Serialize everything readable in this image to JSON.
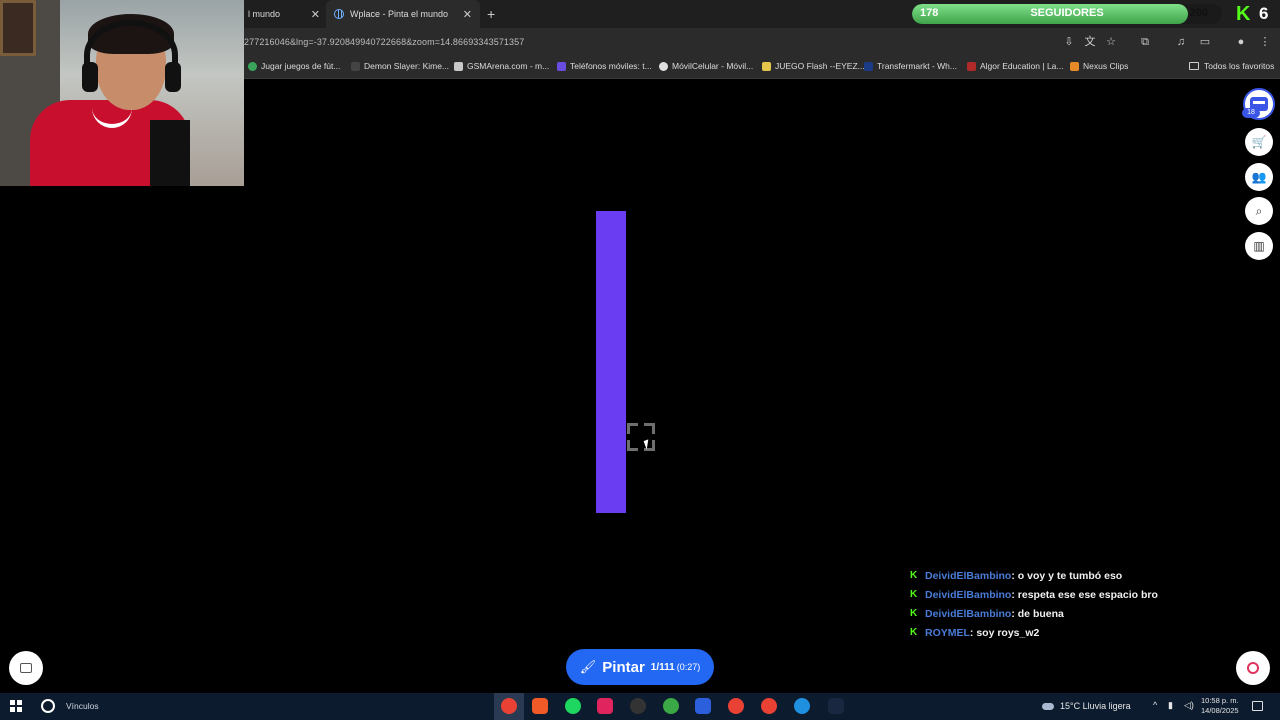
{
  "browser": {
    "tabs": [
      {
        "label": "l mundo"
      },
      {
        "label": "Wplace - Pinta el mundo"
      }
    ],
    "url": "277216046&lng=-37.920849940722668&zoom=14.86693343571357",
    "bookmarks": [
      {
        "label": "Jugar juegos de fút...",
        "color": "#3aa55a"
      },
      {
        "label": "Demon Slayer: Kime...",
        "color": "#2b2b2b"
      },
      {
        "label": "GSMArena.com - m...",
        "color": "#c9c9c9"
      },
      {
        "label": "Teléfonos móviles: t...",
        "color": "#6a4ce0"
      },
      {
        "label": "MóvilCelular - Móvil...",
        "color": "#e0e0e0"
      },
      {
        "label": "JUEGO Flash --EYEZ...",
        "color": "#e6c64a"
      },
      {
        "label": "Transfermarkt - Wh...",
        "color": "#1b3b86"
      },
      {
        "label": "Algor Education | La...",
        "color": "#b02a2a"
      },
      {
        "label": "Nexus Clips",
        "color": "#e58a26"
      }
    ],
    "favorites_label": "Todos los favoritos"
  },
  "overlay": {
    "followers_current": "178",
    "followers_label": "SEGUIDORES",
    "followers_goal": "200",
    "followers_progress": 0.89,
    "platform_logo": "K",
    "top_right_number": "6",
    "kick_color": "#53fc18"
  },
  "chat": [
    {
      "user": "DeividElBambino",
      "message": ": o voy y te tumbó eso"
    },
    {
      "user": "DeividElBambino",
      "message": ": respeta ese ese espacio bro"
    },
    {
      "user": "DeividElBambino",
      "message": ": de buena"
    },
    {
      "user": "ROYMEL",
      "message": ": soy roys_w2"
    }
  ],
  "canvas": {
    "pixel_color": "#6a3cf2"
  },
  "side_toolbar": {
    "profile_badge": "18",
    "icons": [
      "store-icon",
      "users-icon",
      "search-map-icon",
      "leaderboard-icon"
    ]
  },
  "paint_button": {
    "label": "Pintar",
    "count": "1/111",
    "timer": "(0:27)",
    "color": "#2368f2"
  },
  "taskbar": {
    "search_label": "Vínculos",
    "weather": "15°C  Lluvia ligera",
    "time": "10:58 p. m.",
    "date": "14/08/2025"
  }
}
